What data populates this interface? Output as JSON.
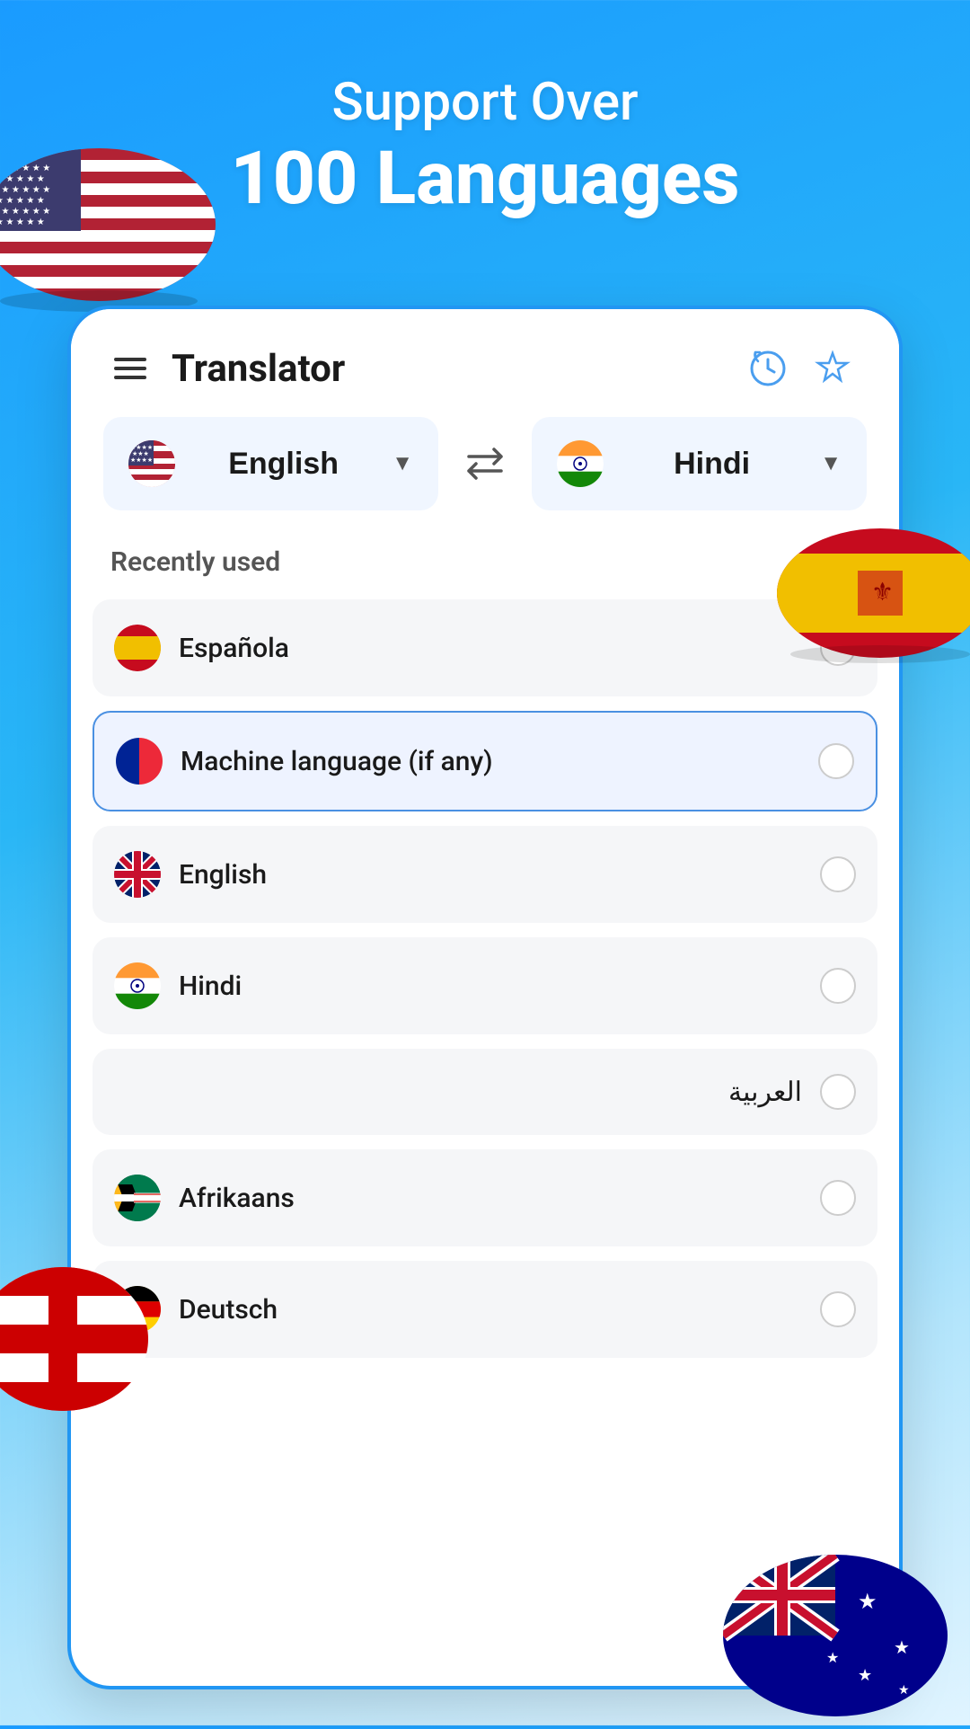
{
  "hero": {
    "subtitle": "Support Over",
    "title": "100 Languages"
  },
  "app": {
    "title": "Translator"
  },
  "header": {
    "history_icon": "🕐",
    "favorite_icon": "☆"
  },
  "language_selector": {
    "source_language": "English",
    "target_language": "Hindi",
    "swap_label": "⇄"
  },
  "recently_used_label": "Recently used",
  "language_list": [
    {
      "id": 1,
      "name": "Española",
      "flag_type": "spain",
      "selected": false
    },
    {
      "id": 2,
      "name": "Machine language (if any)",
      "flag_type": "france",
      "selected": true
    },
    {
      "id": 3,
      "name": "English",
      "flag_type": "uk",
      "selected": false
    },
    {
      "id": 4,
      "name": "Hindi",
      "flag_type": "hindi",
      "selected": false
    },
    {
      "id": 5,
      "name": "العربية",
      "flag_type": "arabic",
      "selected": false,
      "rtl": true
    },
    {
      "id": 6,
      "name": "Afrikaans",
      "flag_type": "afrikaans",
      "selected": false
    },
    {
      "id": 7,
      "name": "Deutsch",
      "flag_type": "german",
      "selected": false
    }
  ]
}
